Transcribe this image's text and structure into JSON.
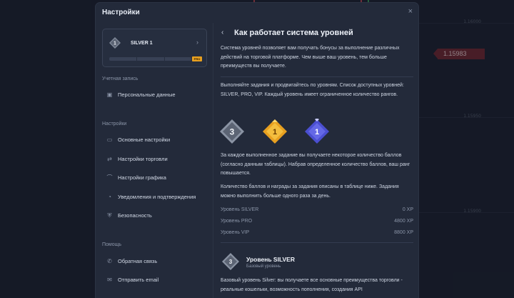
{
  "background": {
    "price_tag": "1.15983",
    "axis_labels": [
      "1.16000",
      "1.15950",
      "1.15900"
    ]
  },
  "modal": {
    "title": "Настройки",
    "close_label": "×"
  },
  "level_card": {
    "badge_number": "1",
    "name": "SILVER 1",
    "arrow": "›",
    "pro_label": "PRO",
    "progress": 0
  },
  "sidebar": {
    "account_section": "Учетная запись",
    "account_items": [
      {
        "label": "Персональные данные",
        "icon": "id-card-icon"
      }
    ],
    "settings_section": "Настройки",
    "settings_items": [
      {
        "label": "Основные настройки",
        "icon": "laptop-icon"
      },
      {
        "label": "Настройки торговли",
        "icon": "arrows-icon"
      },
      {
        "label": "Настройки графика",
        "icon": "chart-icon"
      },
      {
        "label": "Уведомления и подтверждения",
        "icon": "bell-icon"
      },
      {
        "label": "Безопасность",
        "icon": "shield-icon"
      }
    ],
    "help_section": "Помощь",
    "help_items": [
      {
        "label": "Обратная связь",
        "icon": "phone-icon"
      },
      {
        "label": "Отправить email",
        "icon": "mail-icon"
      }
    ]
  },
  "content": {
    "back_label": "‹",
    "title": "Как работает система уровней",
    "intro": "Система уровней позволяет вам получать бонусы за выполнение различных действий на торговой платформе. Чем выше ваш уровень, тем больше преимуществ вы получаете.",
    "tasks": "Выполняйте задания и продвигайтесь по уровням. Список доступных уровней: SILVER, PRO, VIP. Каждый уровень имеет ограниченное количество рангов.",
    "badges": {
      "silver_number": "3",
      "pro_number": "1",
      "vip_number": "1"
    },
    "points": "За каждое выполненное задание вы получаете некоторое количество баллов (согласно данным таблицы). Набрав определенное количество баллов, ваш ранг повышается.",
    "rewards": "Количество баллов и награды за задания описаны в таблице ниже. Задания можно выполнить больше одного раза за день.",
    "xp_table": [
      {
        "label": "Уровень SILVER",
        "value": "0 XP"
      },
      {
        "label": "Уровень PRO",
        "value": "4800 XP"
      },
      {
        "label": "Уровень VIP",
        "value": "8800 XP"
      }
    ],
    "level_section": {
      "badge_number": "3",
      "title": "Уровень SILVER",
      "subtitle": "Базовый уровень",
      "description": "Базовый уровень Silver: вы получаете все основные преимущества торговли - реальные кошельки, возможность пополнения, создания API"
    }
  },
  "colors": {
    "modal_bg": "#232a3a",
    "price_tag": "#7a2b35",
    "pro_gold": "#e8a020",
    "silver": "#7f8898",
    "vip": "#4b4fd1"
  }
}
